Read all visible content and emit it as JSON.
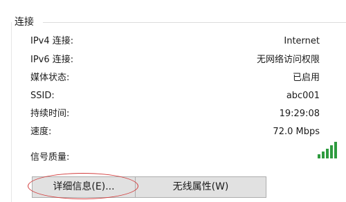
{
  "section": {
    "title": "连接"
  },
  "rows": [
    {
      "label": "IPv4 连接:",
      "value": "Internet"
    },
    {
      "label": "IPv6 连接:",
      "value": "无网络访问权限"
    },
    {
      "label": "媒体状态:",
      "value": "已启用"
    },
    {
      "label": "SSID:",
      "value": "abc001"
    },
    {
      "label": "持续时间:",
      "value": "19:29:08"
    },
    {
      "label": "速度:",
      "value": "72.0 Mbps"
    }
  ],
  "signal": {
    "label": "信号质量:",
    "icon": "signal-strength-icon",
    "bars_total": 5,
    "bars_filled": 5,
    "color": "#2e9b3f"
  },
  "buttons": {
    "details_label": "详细信息(E)...",
    "wireless_properties_label": "无线属性(W)"
  },
  "annotation": {
    "color": "#d23b3b"
  }
}
